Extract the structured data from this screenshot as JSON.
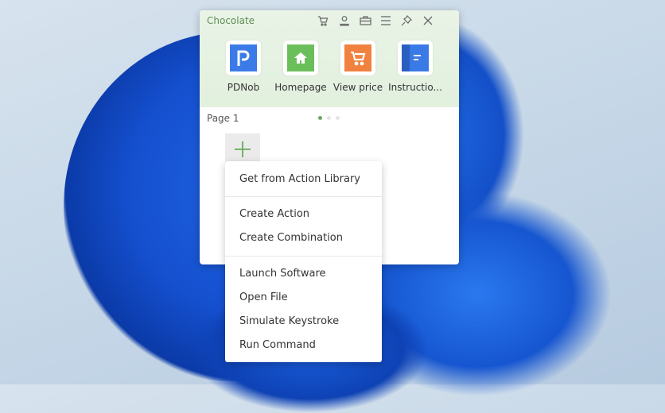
{
  "window": {
    "title": "Chocolate",
    "toolbar_icons": [
      "cart-icon",
      "user-icon",
      "toolbox-icon",
      "menu-icon",
      "pin-icon",
      "close-icon"
    ]
  },
  "apps": [
    {
      "label": "PDNob",
      "color": "#3b7be8"
    },
    {
      "label": "Homepage",
      "color": "#6bbf5a"
    },
    {
      "label": "View price",
      "color": "#f0813f"
    },
    {
      "label": "Instructio...",
      "color": "#3a78e0"
    }
  ],
  "page": {
    "label": "Page 1",
    "current": 1,
    "total": 3
  },
  "accent": "#6aaa5e",
  "menu": {
    "groups": [
      [
        "Get from Action Library"
      ],
      [
        "Create Action",
        "Create Combination"
      ],
      [
        "Launch Software",
        "Open File",
        "Simulate Keystroke",
        "Run Command"
      ]
    ]
  }
}
